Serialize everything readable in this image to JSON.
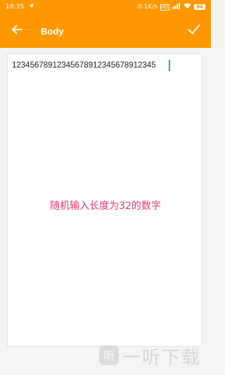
{
  "status_bar": {
    "time": "18:35",
    "network_speed": "0.1K/s",
    "battery": "84"
  },
  "app_bar": {
    "title": "Body"
  },
  "editor": {
    "value": "12345678912345678912345678912345"
  },
  "overlay": {
    "message": "随机输入长度为32的数字"
  },
  "watermark": {
    "text": "一听下载"
  },
  "colors": {
    "accent": "#ff9800",
    "message": "#e23b6e",
    "cursor": "#2196f3"
  }
}
